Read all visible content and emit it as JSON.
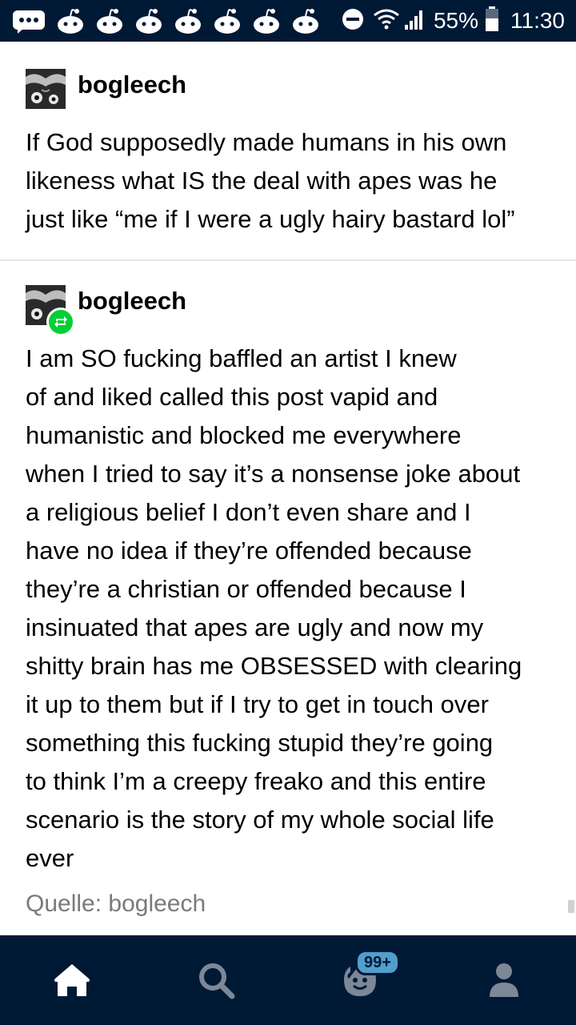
{
  "status_bar": {
    "battery": "55%",
    "time": "11:30",
    "notification_icons": [
      "chat-bubble-icon",
      "reddit-alien-icon",
      "reddit-alien-icon",
      "reddit-alien-icon",
      "reddit-alien-icon",
      "reddit-alien-icon",
      "reddit-alien-icon",
      "reddit-alien-icon"
    ]
  },
  "posts": [
    {
      "username": "bogleech",
      "body": "If God supposedly made humans in his own\nlikeness what IS the deal with apes was he\njust like “me if I were a ugly hairy bastard lol”"
    },
    {
      "username": "bogleech",
      "reblogged": true,
      "body": "I am SO fucking baffled an artist I knew\nof and liked called this post vapid and\nhumanistic and blocked me everywhere\nwhen I tried to say it’s a nonsense joke about\na religious belief I don’t even share and I\nhave no idea if they’re offended because\nthey’re a christian or offended because I\ninsinuated that apes are ugly and now my\nshitty brain has me OBSESSED with clearing\nit up to them but if I try to get in touch over\nsomething this fucking stupid they’re going\nto think I’m a creepy freako and this entire\nscenario is the story of my whole social life\never"
    }
  ],
  "source": "Quelle: bogleech",
  "nav": {
    "items": [
      "home-icon",
      "search-icon",
      "activity-icon",
      "account-icon"
    ],
    "activity_badge": "99+"
  },
  "colors": {
    "navy": "#001935",
    "reblog_green": "#00cf35",
    "badge_blue": "#529ecc",
    "nav_icon": "#ffffff",
    "nav_icon_dim": "#7c8797"
  }
}
